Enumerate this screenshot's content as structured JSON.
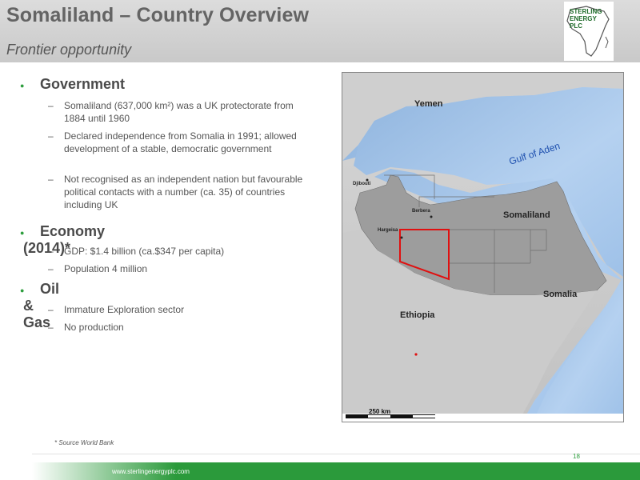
{
  "header": {
    "title": "Somaliland – Country Overview",
    "subtitle": "Frontier opportunity",
    "logo_text": "STERLING ENERGY PLC"
  },
  "sections": [
    {
      "heading": "Government",
      "items": [
        "Somaliland (637,000 km²) was a UK protectorate from 1884 until 1960",
        "Declared independence from Somalia in 1991; allowed development of a stable, democratic government",
        "Not recognised as an independent nation but favourable political contacts with a number (ca. 35) of countries including UK"
      ]
    },
    {
      "heading": "Economy (2014)*",
      "items": [
        "GDP: $1.4 billion (ca.$347 per capita)",
        "Population 4 million"
      ]
    },
    {
      "heading": "Oil & Gas",
      "items": [
        "Immature Exploration sector",
        "No production"
      ]
    }
  ],
  "map": {
    "labels": {
      "yemen": "Yemen",
      "gulf": "Gulf of Aden",
      "djibouti": "Djibouti",
      "berbera": "Berbera",
      "somaliland": "Somaliland",
      "hargeisa": "Hargeisa",
      "somalia": "Somalia",
      "ethiopia": "Ethiopia"
    },
    "scale": "250 km"
  },
  "footnote": "* Source World Bank",
  "page_number": "18",
  "url": "www.sterlingenergyplc.com",
  "colors": {
    "accent_green": "#2b9a3b",
    "block_outline_red": "#e01010",
    "sea": "#a9c9ec"
  }
}
